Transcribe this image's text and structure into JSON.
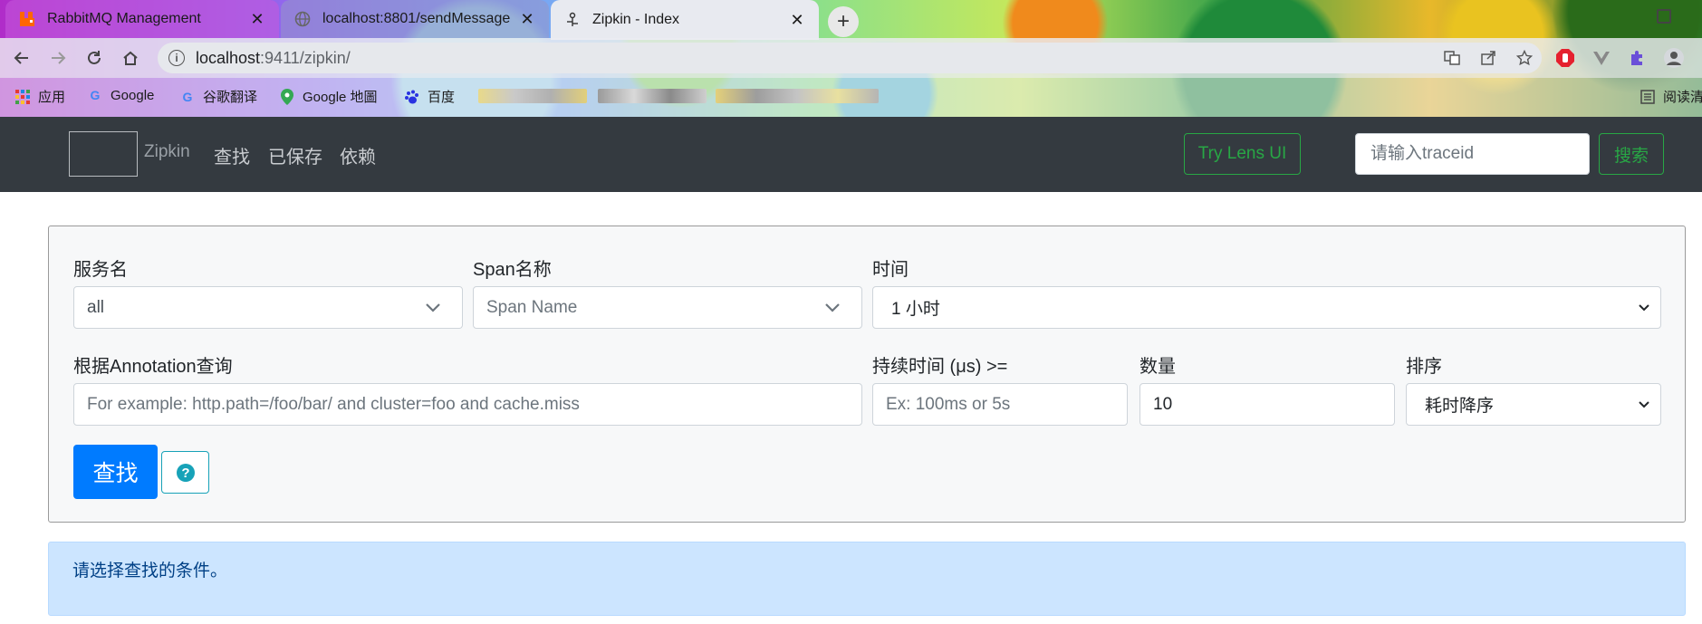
{
  "browser": {
    "tabs": [
      {
        "title": "RabbitMQ Management",
        "close": "✕"
      },
      {
        "title": "localhost:8801/sendMessage",
        "close": "✕"
      },
      {
        "title": "Zipkin - Index",
        "close": "✕"
      }
    ],
    "new_tab": "+",
    "url_host": "localhost",
    "url_rest": ":9411/zipkin/",
    "bookmarks": [
      {
        "label": "应用"
      },
      {
        "label": "Google"
      },
      {
        "label": "谷歌翻译"
      },
      {
        "label": "Google 地圖"
      },
      {
        "label": "百度"
      },
      {
        "label": "阅读清单"
      }
    ]
  },
  "navbar": {
    "brand": "Zipkin",
    "links": [
      "查找",
      "已保存",
      "依赖"
    ],
    "lens_button": "Try Lens UI",
    "traceid_placeholder": "请输入traceid",
    "search_button": "搜索"
  },
  "form": {
    "service_label": "服务名",
    "service_value": "all",
    "span_label": "Span名称",
    "span_placeholder": "Span Name",
    "time_label": "时间",
    "time_value": "1 小时",
    "annotation_label": "根据Annotation查询",
    "annotation_placeholder": "For example: http.path=/foo/bar/ and cluster=foo and cache.miss",
    "duration_label": "持续时间 (μs) >=",
    "duration_placeholder": "Ex: 100ms or 5s",
    "limit_label": "数量",
    "limit_value": "10",
    "sort_label": "排序",
    "sort_value": "耗时降序",
    "find_button": "查找",
    "help_icon": "?"
  },
  "alert": {
    "text": "请选择查找的条件。"
  },
  "colors": {
    "navbar_bg": "#343a40",
    "success": "#28a745",
    "primary": "#007bff",
    "info": "#17a2b8",
    "alert_bg": "#cce5ff"
  }
}
